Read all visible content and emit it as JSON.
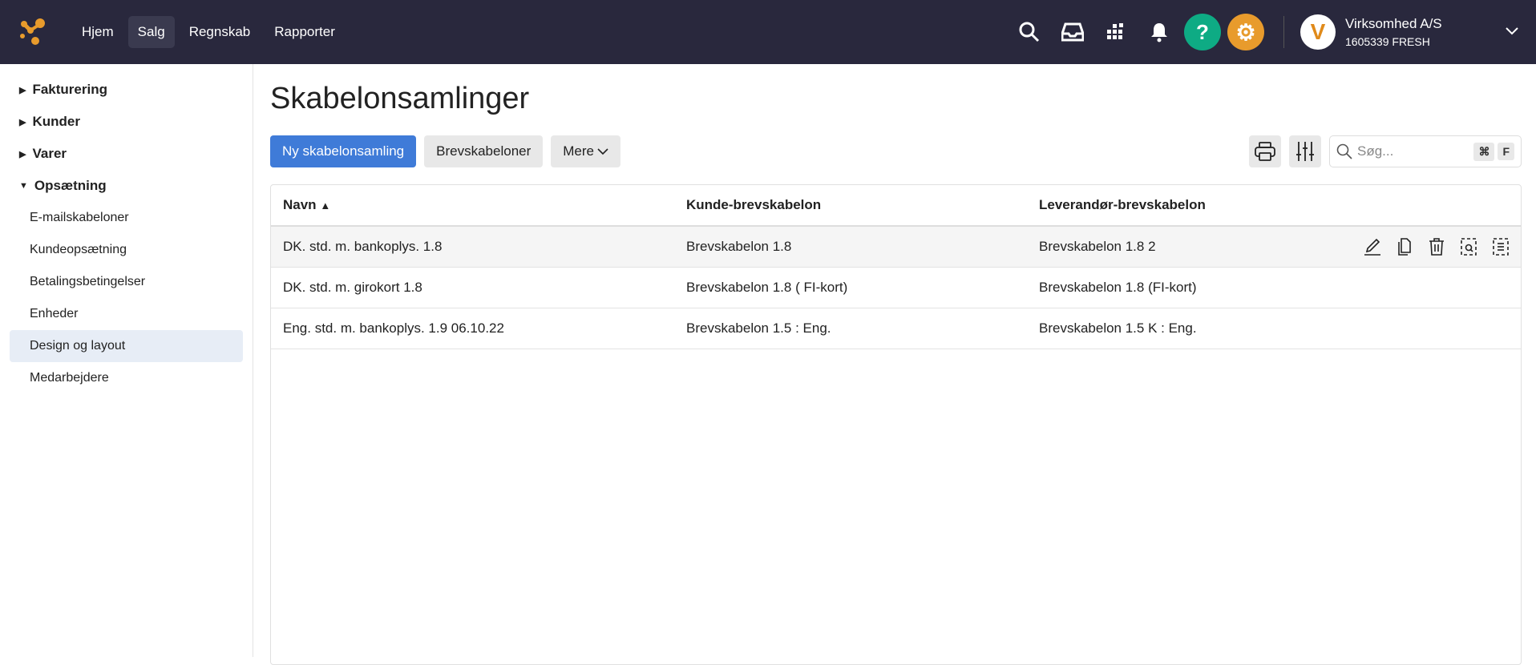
{
  "nav": {
    "items": [
      "Hjem",
      "Salg",
      "Regnskab",
      "Rapporter"
    ],
    "active": "Salg"
  },
  "header": {
    "company": "Virksomhed A/S",
    "company_id": "1605339 FRESH",
    "help": "?"
  },
  "sidebar": {
    "sections": [
      "Fakturering",
      "Kunder",
      "Varer",
      "Opsætning"
    ],
    "items": [
      "E-mailskabeloner",
      "Kundeopsætning",
      "Betalingsbetingelser",
      "Enheder",
      "Design og layout",
      "Medarbejdere"
    ],
    "active": "Design og layout"
  },
  "page": {
    "title": "Skabelonsamlinger",
    "new_button": "Ny skabelonsamling",
    "templates_button": "Brevskabeloner",
    "more_button": "Mere",
    "search_placeholder": "Søg...",
    "kbd_cmd": "⌘",
    "kbd_f": "F"
  },
  "table": {
    "columns": [
      "Navn",
      "Kunde-brevskabelon",
      "Leverandør-brevskabelon"
    ],
    "rows": [
      [
        "DK. std. m. bankoplys. 1.8",
        "Brevskabelon 1.8",
        "Brevskabelon 1.8 2"
      ],
      [
        "DK. std. m. girokort 1.8",
        "Brevskabelon 1.8 ( FI-kort)",
        "Brevskabelon 1.8 (FI-kort)"
      ],
      [
        "Eng. std. m. bankoplys. 1.9 06.10.22",
        "Brevskabelon 1.5 : Eng.",
        "Brevskabelon 1.5 K : Eng."
      ]
    ]
  },
  "colors": {
    "header_bg": "#29283d",
    "primary": "#3f7bd8",
    "help": "#0eab84",
    "settings": "#e89b2c"
  }
}
